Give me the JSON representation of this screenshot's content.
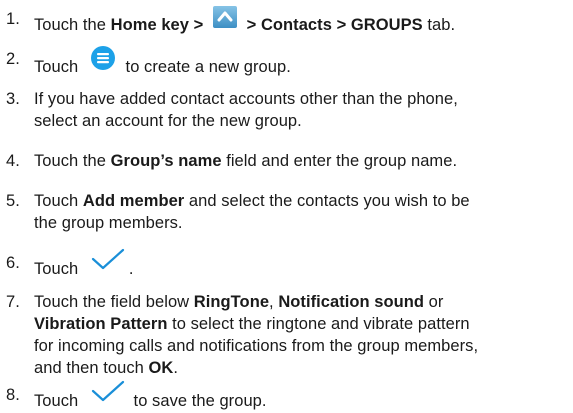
{
  "steps": [
    {
      "num": "1.",
      "a": "Touch the ",
      "b1": "Home",
      "c": " key > ",
      "d": " > ",
      "e": "Contacts",
      "f": " > ",
      "g": "GROUPS",
      "h": " tab."
    },
    {
      "num": "2.",
      "a": "Touch ",
      "b": " to create a new group."
    },
    {
      "num": "3.",
      "l1": "If you have added contact accounts other than the phone,",
      "l2": "select an account for the new group."
    },
    {
      "num": "4.",
      "a": "Touch the ",
      "b": "Group’s name",
      "c": " field and enter the group name."
    },
    {
      "num": "5.",
      "a": "Touch ",
      "b": "Add member",
      "c": " and select the contacts you wish to be",
      "l2": "the group members."
    },
    {
      "num": "6.",
      "a": "Touch ",
      "c": "."
    },
    {
      "num": "7.",
      "a": "Touch the field below ",
      "b": "RingTone",
      "c": ", ",
      "d": "Notification sound",
      "e": " or",
      "l2b": "Vibration Pattern",
      "l2": " to select the ringtone and vibrate pattern",
      "l3": "for incoming calls and notifications from the group members,",
      "l4": "and then touch ",
      "l4b": "OK",
      "l4c": "."
    },
    {
      "num": "8.",
      "a": "Touch ",
      "c": " to save the group."
    }
  ],
  "icons": {
    "apps": "apps-launcher-icon",
    "add_group": "add-group-icon",
    "check": "checkmark-icon",
    "accent": "#1da1e8"
  }
}
